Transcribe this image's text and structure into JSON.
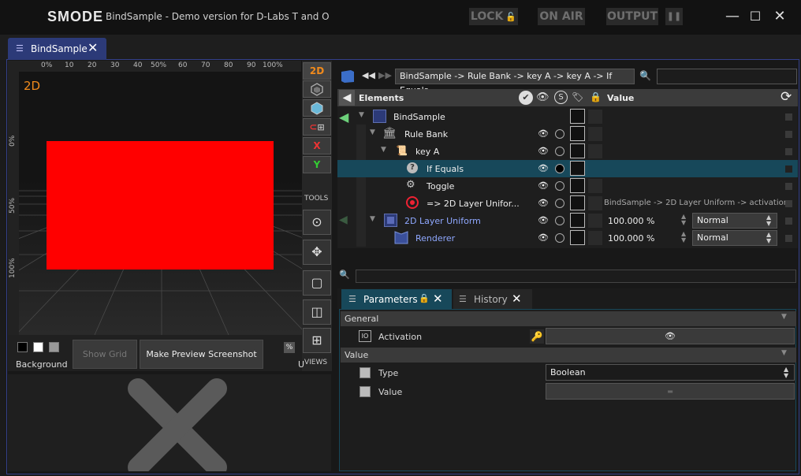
{
  "titlebar": {
    "logo": "SMODE",
    "title": "BindSample - Demo version for D-Labs T and O",
    "lock": "LOCK",
    "lock_icon": "🔓",
    "on_air": "ON AIR",
    "output": "OUTPUT",
    "pause": "❚❚",
    "minimize": "—",
    "maximize": "☐",
    "close": "✕"
  },
  "tab": {
    "label": "BindSample",
    "icon": "☰",
    "close": "✕"
  },
  "viewport": {
    "mode_label": "2D",
    "ruler_top": [
      "0%",
      "10",
      "20",
      "30",
      "40",
      "50%",
      "60",
      "70",
      "80",
      "90",
      "100%"
    ],
    "ruler_left": [
      "0%",
      "50%",
      "100%"
    ],
    "tools": {
      "btn_2d": "2D",
      "btn_x": "X",
      "btn_y": "Y",
      "tools_label": "TOOLS",
      "views_label": "VIEWS",
      "magnet": "⊂",
      "compass": "⊙",
      "move": "✥",
      "square": "▢",
      "cube": "◫",
      "grid": "⊞"
    },
    "background_label": "Background",
    "show_grid": "Show Grid",
    "make_preview": "Make Preview Screenshot",
    "percent_btn": "%",
    "cut_label": "U"
  },
  "navigation": {
    "back": "◀◀",
    "forward": "▶▶",
    "breadcrumb": "BindSample -> Rule Bank -> key A -> key A -> If Equals",
    "search_placeholder": ""
  },
  "tree": {
    "header_elements": "Elements",
    "header_value": "Value",
    "header_s": "S",
    "refresh": "⟳",
    "rows": [
      {
        "label": "BindSample",
        "expand": "▼"
      },
      {
        "label": "Rule Bank",
        "expand": "▼"
      },
      {
        "label": "key A",
        "expand": "▼"
      },
      {
        "label": "If Equals",
        "expand": ""
      },
      {
        "label": "Toggle",
        "expand": ""
      },
      {
        "label": "=> 2D Layer Unifor...",
        "expand": ""
      },
      {
        "label": "2D Layer Uniform",
        "expand": "▼"
      },
      {
        "label": "Renderer",
        "expand": ""
      }
    ],
    "bind_value": "BindSample -> 2D Layer Uniform -> activation",
    "uniform_pct": "100.000 %",
    "uniform_blend": "Normal",
    "renderer_pct": "100.000 %",
    "renderer_blend": "Normal"
  },
  "params": {
    "tab_parameters": "Parameters",
    "tab_history": "History",
    "tab_icon": "☰",
    "tab_close": "✕",
    "lock_icon": "🔒",
    "section_general": "General",
    "activation_label": "Activation",
    "io_icon": "IO",
    "section_value": "Value",
    "type_label": "Type",
    "type_value": "Boolean",
    "value_label": "Value",
    "value_indicator": "▬"
  }
}
